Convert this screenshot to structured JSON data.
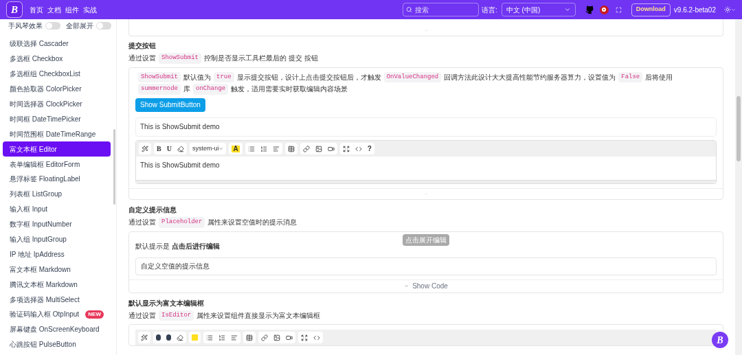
{
  "header": {
    "logo": "B",
    "nav": [
      "首页",
      "文档",
      "组件",
      "实战"
    ],
    "search": {
      "placeholder": "搜索"
    },
    "language_label": "语言:",
    "language": "中文 (中国)",
    "download": "Download",
    "version": "v9.6.2-beta02"
  },
  "sidebar": {
    "toggles": [
      {
        "label": "手风琴效果",
        "on": false
      },
      {
        "label": "全部展开",
        "on": false
      }
    ],
    "items": [
      {
        "label": "级联选择 Cascader",
        "selected": false
      },
      {
        "label": "多选框 Checkbox",
        "selected": false
      },
      {
        "label": "多选框组 CheckboxList",
        "selected": false
      },
      {
        "label": "颜色拾取器 ColorPicker",
        "selected": false
      },
      {
        "label": "时间选择器 ClockPicker",
        "selected": false
      },
      {
        "label": "时间框 DateTimePicker",
        "selected": false
      },
      {
        "label": "时间范围框 DateTimeRange",
        "selected": false
      },
      {
        "label": "富文本框 Editor",
        "selected": true
      },
      {
        "label": "表单编辑框 EditorForm",
        "selected": false
      },
      {
        "label": "悬浮标签 FloatingLabel",
        "selected": false
      },
      {
        "label": "列表框 ListGroup",
        "selected": false
      },
      {
        "label": "输入框 Input",
        "selected": false
      },
      {
        "label": "数字框 InputNumber",
        "selected": false
      },
      {
        "label": "输入组 InputGroup",
        "selected": false
      },
      {
        "label": "IP 地址 IpAddress",
        "selected": false
      },
      {
        "label": "富文本框 Markdown",
        "selected": false
      },
      {
        "label": "腾讯文本框 Markdown",
        "selected": false
      },
      {
        "label": "多项选择器 MultiSelect",
        "selected": false
      },
      {
        "label": "验证码输入框 OtpInput",
        "selected": false,
        "badge": "NEW"
      },
      {
        "label": "屏幕键盘 OnScreenKeyboard",
        "selected": false
      },
      {
        "label": "心跳按钮 PulseButton",
        "selected": false
      }
    ]
  },
  "sections": [
    {
      "title": "提交按钮",
      "desc": [
        {
          "kind": "text",
          "text": "通过设置"
        },
        {
          "kind": "code",
          "text": "ShowSubmit"
        },
        {
          "kind": "text",
          "text": "控制是否显示工具栏最后的 提交 按钮"
        }
      ],
      "note": [
        {
          "kind": "code",
          "text": "ShowSubmit"
        },
        {
          "kind": "text",
          "text": "默认值为"
        },
        {
          "kind": "code",
          "text": "true"
        },
        {
          "kind": "text",
          "text": "显示提交按钮，设计上点击提交按钮后，才触发"
        },
        {
          "kind": "code",
          "text": "OnValueChanged"
        },
        {
          "kind": "text",
          "text": "回调方法此设计大大提高性能节约服务器算力，设置值为"
        },
        {
          "kind": "code",
          "text": "False"
        },
        {
          "kind": "text",
          "text": "后将使用"
        },
        {
          "kind": "code",
          "text": "summernode"
        },
        {
          "kind": "text",
          "text": "库"
        },
        {
          "kind": "code",
          "text": "onChange"
        },
        {
          "kind": "text",
          "text": "触发，适用需要实时获取编辑内容场景"
        }
      ],
      "button": "Show SubmitButton",
      "textarea": "This is ShowSubmit demo",
      "editor": {
        "font": "system-ui",
        "content": "This is ShowSubmit demo"
      }
    },
    {
      "title": "自定义提示信息",
      "desc": [
        {
          "kind": "text",
          "text": "通过设置"
        },
        {
          "kind": "code",
          "text": "Placeholder"
        },
        {
          "kind": "text",
          "text": "属性来设置空值时的提示消息"
        }
      ],
      "hint": "默认提示是 **点击后进行编辑**",
      "tooltip": "点击展开编辑",
      "field": "自定义空值的提示信息",
      "show_code": "Show Code"
    },
    {
      "title": "默认显示为富文本编辑框",
      "desc": [
        {
          "kind": "text",
          "text": "通过设置"
        },
        {
          "kind": "code",
          "text": "IsEditor"
        },
        {
          "kind": "text",
          "text": "属性来设置组件直接显示为富文本编辑框"
        }
      ]
    }
  ],
  "toolbar": {
    "bold": "B",
    "underline": "U",
    "font_color_glyph": "A",
    "help": "?"
  },
  "floating_logo": "B"
}
